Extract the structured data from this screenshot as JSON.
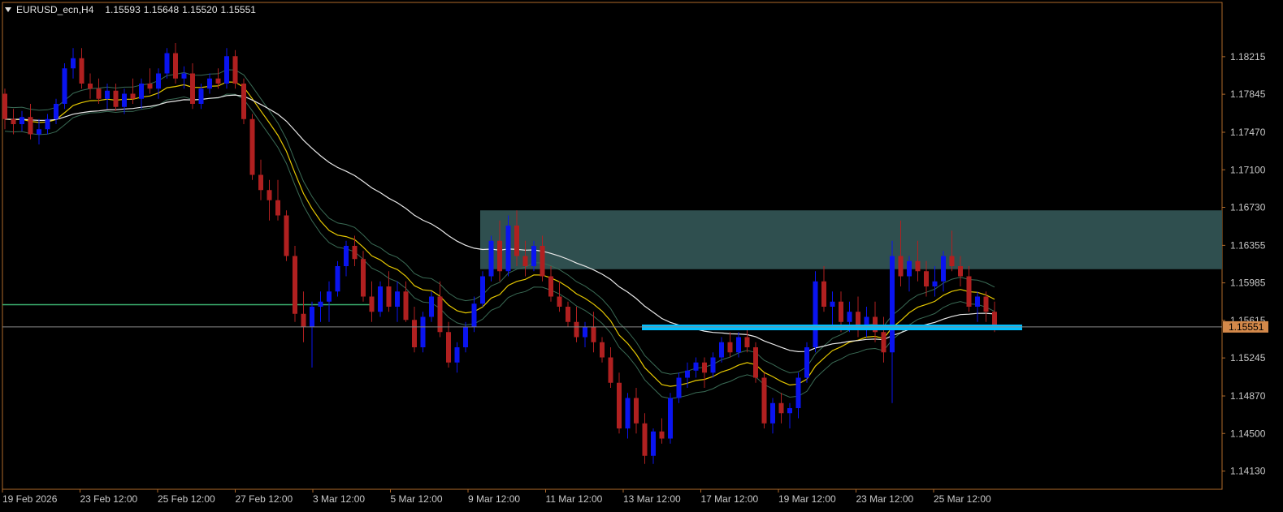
{
  "header": {
    "symbol": "EURUSD_ecn,H4",
    "open": "1.15593",
    "high": "1.15648",
    "low": "1.15520",
    "close": "1.15551"
  },
  "price_axis": {
    "labels": [
      "1.18215",
      "1.17845",
      "1.17470",
      "1.17100",
      "1.16730",
      "1.16355",
      "1.15985",
      "1.15615",
      "1.15245",
      "1.14870",
      "1.14500",
      "1.14130"
    ],
    "current_price_label": "1.15551"
  },
  "time_axis": {
    "labels": [
      "19 Feb 2026",
      "23 Feb 12:00",
      "25 Feb 12:00",
      "27 Feb 12:00",
      "3 Mar 12:00",
      "5 Mar 12:00",
      "9 Mar 12:00",
      "11 Mar 12:00",
      "13 Mar 12:00",
      "17 Mar 12:00",
      "19 Mar 12:00",
      "23 Mar 12:00",
      "25 Mar 12:00"
    ]
  },
  "colors": {
    "background": "#000000",
    "frame": "#b06a2a",
    "bull_candle": "#0a14f0",
    "bear_candle": "#b02020",
    "supply_zone": "#2f4f4f",
    "support_line": "#00bfff",
    "horizontal_line": "#3cb371",
    "ema_fast": "#e6c800",
    "ema_slow": "#e8e8e8",
    "bands": "#3a6b55",
    "current_price_bg": "#d4894a"
  },
  "chart_data": {
    "type": "candlestick",
    "symbol": "EURUSD_ecn",
    "timeframe": "H4",
    "ylim": [
      1.1395,
      1.1875
    ],
    "last_price": 1.15551,
    "candles": [
      [
        1.1785,
        1.179,
        1.175,
        1.176
      ],
      [
        1.176,
        1.177,
        1.1745,
        1.1755
      ],
      [
        1.1755,
        1.1768,
        1.1748,
        1.1762
      ],
      [
        1.1762,
        1.1775,
        1.174,
        1.1745
      ],
      [
        1.1745,
        1.176,
        1.1735,
        1.175
      ],
      [
        1.175,
        1.1765,
        1.1745,
        1.176
      ],
      [
        1.176,
        1.178,
        1.1755,
        1.1775
      ],
      [
        1.1775,
        1.1815,
        1.177,
        1.181
      ],
      [
        1.181,
        1.183,
        1.18,
        1.182
      ],
      [
        1.182,
        1.183,
        1.179,
        1.1795
      ],
      [
        1.1795,
        1.1805,
        1.178,
        1.179
      ],
      [
        1.179,
        1.18,
        1.1775,
        1.178
      ],
      [
        1.178,
        1.1795,
        1.177,
        1.1788
      ],
      [
        1.1788,
        1.1795,
        1.1768,
        1.1772
      ],
      [
        1.1772,
        1.179,
        1.1765,
        1.1785
      ],
      [
        1.1785,
        1.18,
        1.1775,
        1.178
      ],
      [
        1.178,
        1.18,
        1.177,
        1.1795
      ],
      [
        1.1795,
        1.181,
        1.1785,
        1.179
      ],
      [
        1.179,
        1.181,
        1.178,
        1.1805
      ],
      [
        1.1805,
        1.183,
        1.18,
        1.1825
      ],
      [
        1.1825,
        1.1835,
        1.1795,
        1.18
      ],
      [
        1.18,
        1.1812,
        1.179,
        1.1805
      ],
      [
        1.1805,
        1.1815,
        1.177,
        1.1775
      ],
      [
        1.1775,
        1.1795,
        1.177,
        1.179
      ],
      [
        1.179,
        1.1805,
        1.1785,
        1.18
      ],
      [
        1.18,
        1.181,
        1.179,
        1.1795
      ],
      [
        1.1795,
        1.183,
        1.179,
        1.1822
      ],
      [
        1.1822,
        1.1828,
        1.179,
        1.1795
      ],
      [
        1.1795,
        1.18,
        1.1755,
        1.176
      ],
      [
        1.176,
        1.1765,
        1.17,
        1.1705
      ],
      [
        1.1705,
        1.172,
        1.168,
        1.169
      ],
      [
        1.169,
        1.17,
        1.166,
        1.168
      ],
      [
        1.168,
        1.17,
        1.166,
        1.1665
      ],
      [
        1.1665,
        1.167,
        1.162,
        1.1625
      ],
      [
        1.1625,
        1.1635,
        1.156,
        1.1568
      ],
      [
        1.1568,
        1.159,
        1.154,
        1.1555
      ],
      [
        1.1555,
        1.158,
        1.1515,
        1.1575
      ],
      [
        1.1575,
        1.159,
        1.156,
        1.158
      ],
      [
        1.158,
        1.16,
        1.156,
        1.159
      ],
      [
        1.159,
        1.162,
        1.1585,
        1.1615
      ],
      [
        1.1615,
        1.164,
        1.1605,
        1.1635
      ],
      [
        1.1635,
        1.1645,
        1.1615,
        1.1622
      ],
      [
        1.1622,
        1.163,
        1.158,
        1.1585
      ],
      [
        1.1585,
        1.16,
        1.156,
        1.157
      ],
      [
        1.157,
        1.16,
        1.1565,
        1.1595
      ],
      [
        1.1595,
        1.161,
        1.157,
        1.1575
      ],
      [
        1.1575,
        1.16,
        1.156,
        1.159
      ],
      [
        1.159,
        1.16,
        1.156,
        1.1562
      ],
      [
        1.1562,
        1.1575,
        1.153,
        1.1535
      ],
      [
        1.1535,
        1.157,
        1.153,
        1.1565
      ],
      [
        1.1565,
        1.159,
        1.156,
        1.1585
      ],
      [
        1.1585,
        1.16,
        1.1545,
        1.155
      ],
      [
        1.155,
        1.156,
        1.1515,
        1.152
      ],
      [
        1.152,
        1.154,
        1.151,
        1.1535
      ],
      [
        1.1535,
        1.156,
        1.153,
        1.1555
      ],
      [
        1.1555,
        1.1585,
        1.155,
        1.1578
      ],
      [
        1.1578,
        1.161,
        1.1575,
        1.1605
      ],
      [
        1.1605,
        1.1645,
        1.16,
        1.164
      ],
      [
        1.164,
        1.166,
        1.16,
        1.161
      ],
      [
        1.161,
        1.1665,
        1.1605,
        1.1655
      ],
      [
        1.1655,
        1.167,
        1.1615,
        1.1625
      ],
      [
        1.1625,
        1.164,
        1.1605,
        1.1615
      ],
      [
        1.1615,
        1.164,
        1.161,
        1.1635
      ],
      [
        1.1635,
        1.1645,
        1.16,
        1.1605
      ],
      [
        1.1605,
        1.1615,
        1.158,
        1.1585
      ],
      [
        1.1585,
        1.16,
        1.157,
        1.1575
      ],
      [
        1.1575,
        1.158,
        1.1555,
        1.156
      ],
      [
        1.156,
        1.1575,
        1.154,
        1.1545
      ],
      [
        1.1545,
        1.156,
        1.1535,
        1.1555
      ],
      [
        1.1555,
        1.157,
        1.153,
        1.154
      ],
      [
        1.154,
        1.1545,
        1.152,
        1.1525
      ],
      [
        1.1525,
        1.1535,
        1.1495,
        1.15
      ],
      [
        1.15,
        1.151,
        1.145,
        1.1455
      ],
      [
        1.1455,
        1.149,
        1.1445,
        1.1485
      ],
      [
        1.1485,
        1.1495,
        1.145,
        1.146
      ],
      [
        1.146,
        1.147,
        1.142,
        1.1428
      ],
      [
        1.1428,
        1.1455,
        1.142,
        1.1452
      ],
      [
        1.1452,
        1.1465,
        1.144,
        1.1445
      ],
      [
        1.1445,
        1.149,
        1.144,
        1.1485
      ],
      [
        1.1485,
        1.151,
        1.148,
        1.1505
      ],
      [
        1.1505,
        1.152,
        1.1495,
        1.1512
      ],
      [
        1.1512,
        1.1525,
        1.1505,
        1.152
      ],
      [
        1.152,
        1.1525,
        1.1495,
        1.151
      ],
      [
        1.151,
        1.153,
        1.1505,
        1.1525
      ],
      [
        1.1525,
        1.1545,
        1.152,
        1.154
      ],
      [
        1.154,
        1.155,
        1.1525,
        1.153
      ],
      [
        1.153,
        1.155,
        1.1525,
        1.1545
      ],
      [
        1.1545,
        1.1555,
        1.153,
        1.1535
      ],
      [
        1.1535,
        1.154,
        1.15,
        1.1505
      ],
      [
        1.1505,
        1.151,
        1.1455,
        1.146
      ],
      [
        1.146,
        1.1485,
        1.145,
        1.148
      ],
      [
        1.148,
        1.149,
        1.146,
        1.147
      ],
      [
        1.147,
        1.148,
        1.1455,
        1.1475
      ],
      [
        1.1475,
        1.151,
        1.1465,
        1.1505
      ],
      [
        1.1505,
        1.154,
        1.15,
        1.1535
      ],
      [
        1.1535,
        1.161,
        1.153,
        1.16
      ],
      [
        1.16,
        1.1615,
        1.157,
        1.1575
      ],
      [
        1.1575,
        1.159,
        1.1555,
        1.158
      ],
      [
        1.158,
        1.159,
        1.155,
        1.156
      ],
      [
        1.156,
        1.158,
        1.155,
        1.157
      ],
      [
        1.157,
        1.1585,
        1.1545,
        1.1555
      ],
      [
        1.1555,
        1.1575,
        1.1545,
        1.1565
      ],
      [
        1.1565,
        1.158,
        1.154,
        1.155
      ],
      [
        1.155,
        1.1565,
        1.152,
        1.153
      ],
      [
        1.153,
        1.164,
        1.148,
        1.1625
      ],
      [
        1.1625,
        1.166,
        1.1595,
        1.1605
      ],
      [
        1.1605,
        1.1625,
        1.159,
        1.162
      ],
      [
        1.162,
        1.164,
        1.16,
        1.161
      ],
      [
        1.161,
        1.162,
        1.1585,
        1.1595
      ],
      [
        1.1595,
        1.1615,
        1.1585,
        1.16
      ],
      [
        1.16,
        1.163,
        1.159,
        1.1625
      ],
      [
        1.1625,
        1.165,
        1.161,
        1.1615
      ],
      [
        1.1615,
        1.1625,
        1.1595,
        1.1605
      ],
      [
        1.1605,
        1.1615,
        1.157,
        1.1575
      ],
      [
        1.1575,
        1.159,
        1.156,
        1.1585
      ],
      [
        1.1585,
        1.159,
        1.156,
        1.157
      ],
      [
        1.157,
        1.158,
        1.155,
        1.1555
      ]
    ],
    "supply_zone": {
      "top": 1.167,
      "bottom": 1.1612
    },
    "support_level": 1.1555,
    "horizontal_line": 1.1577
  }
}
